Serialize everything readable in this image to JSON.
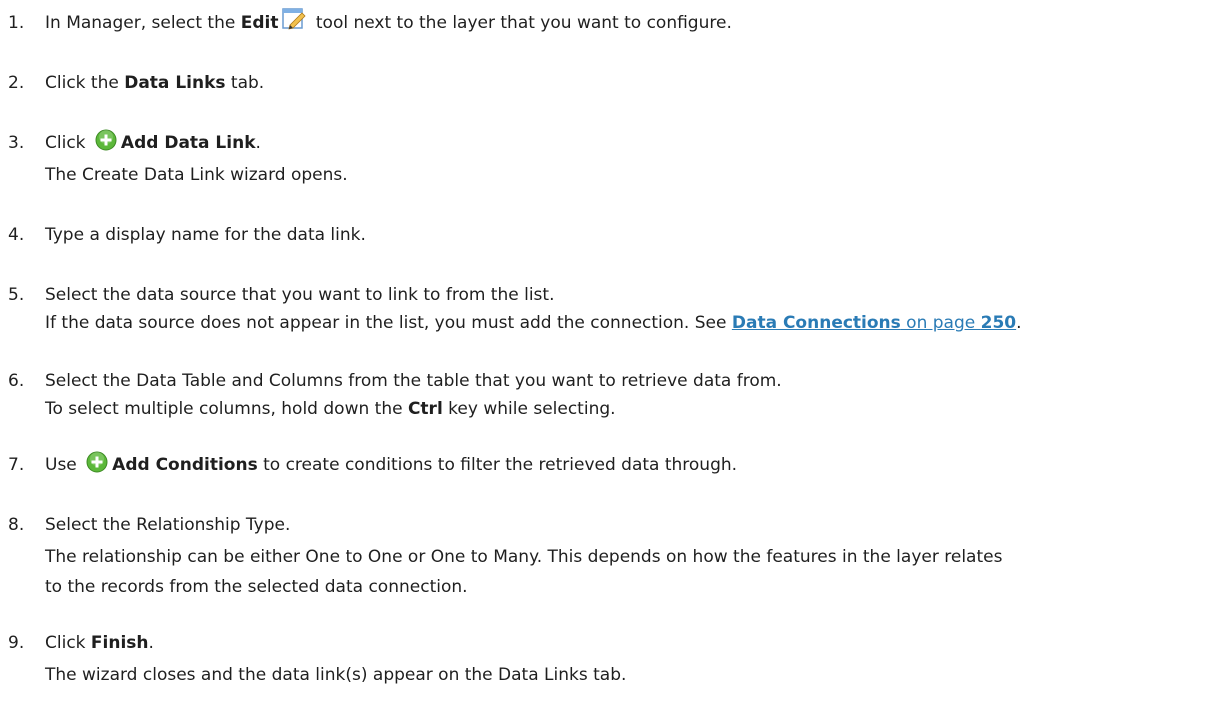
{
  "steps": [
    {
      "num": "1.",
      "text_before": "In Manager, select the ",
      "bold": "Edit",
      "icon": "edit-pencil-icon",
      "text_after": " tool next to the layer that you want to configure."
    },
    {
      "num": "2.",
      "text_before": "Click the ",
      "bold": "Data Links",
      "text_after": " tab."
    },
    {
      "num": "3.",
      "text_before": "Click ",
      "icon": "add-green-circle-icon",
      "bold": "Add Data Link",
      "text_after": ".",
      "sub": [
        "The Create Data Link wizard opens."
      ]
    },
    {
      "num": "4.",
      "text": "Type a display name for the data link."
    },
    {
      "num": "5.",
      "text": "Select the data source that you want to link to from the list.",
      "sub_before": "If the data source does not appear in the list, you must add the connection. See ",
      "link_bold": "Data Connections",
      "link_mid": " on page ",
      "link_page": "250",
      "sub_after": "."
    },
    {
      "num": "6.",
      "text": "Select the Data Table and Columns from the table that you want to retrieve data from.",
      "sub_before": "To select multiple columns, hold down the ",
      "sub_bold": "Ctrl",
      "sub_after": " key while selecting."
    },
    {
      "num": "7.",
      "text_before": "Use ",
      "icon": "add-green-circle-icon",
      "bold": "Add Conditions",
      "text_after": " to create conditions to filter the retrieved data through."
    },
    {
      "num": "8.",
      "text": "Select the Relationship Type.",
      "sub": [
        "The relationship can be either One to One or One to Many. This depends on how the features in the layer relates",
        "to the records from the selected data connection."
      ]
    },
    {
      "num": "9.",
      "text_before": "Click ",
      "bold": "Finish",
      "text_after": ".",
      "sub": [
        "The wizard closes and the data link(s) appear on the Data Links tab."
      ]
    }
  ],
  "colors": {
    "text": "#1f1f1f",
    "link": "#2a7bb5",
    "add_icon": "#5cb83a"
  }
}
